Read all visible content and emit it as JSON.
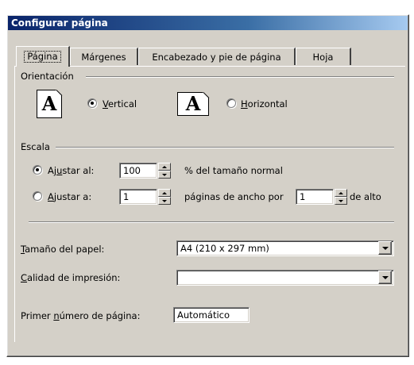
{
  "window": {
    "title": "Configurar página"
  },
  "tabs": [
    {
      "label": "Página",
      "active": true
    },
    {
      "label": "Márgenes",
      "active": false
    },
    {
      "label": "Encabezado y pie de página",
      "active": false
    },
    {
      "label": "Hoja",
      "active": false
    }
  ],
  "orientation": {
    "group_label": "Orientación",
    "portrait_icon_letter": "A",
    "portrait_label_mnemonic": "V",
    "portrait_label_rest": "ertical",
    "portrait_selected": true,
    "landscape_icon_letter": "A",
    "landscape_label_mnemonic": "H",
    "landscape_label_rest": "orizontal",
    "landscape_selected": false
  },
  "scale": {
    "group_label": "Escala",
    "adjust_label_pre": "Aj",
    "adjust_label_mnemonic": "u",
    "adjust_label_post": "star al:",
    "adjust_value": "100",
    "adjust_suffix": "% del tamaño normal",
    "adjust_selected": true,
    "fit_label_mnemonic": "A",
    "fit_label_rest": "justar a:",
    "fit_wide_value": "1",
    "fit_mid_text": "páginas de ancho por",
    "fit_tall_value": "1",
    "fit_suffix": "de alto",
    "fit_selected": false
  },
  "paper": {
    "size_label_mnemonic": "T",
    "size_label_rest": "amaño del papel:",
    "size_value": "A4 (210 x 297 mm)",
    "quality_label_mnemonic": "C",
    "quality_label_rest": "alidad de impresión:",
    "quality_value": "",
    "first_page_label_pre": "Primer ",
    "first_page_label_mnemonic": "n",
    "first_page_label_post": "úmero de página:",
    "first_page_value": "Automático"
  },
  "colors": {
    "dialog_face": "#d4d0c8",
    "title_gradient_start": "#0a246a",
    "title_gradient_end": "#a6caf0"
  },
  "icons": {
    "portrait": "portrait-page-icon",
    "landscape": "landscape-page-icon",
    "spin_up": "spin-up-arrow-icon",
    "spin_down": "spin-down-arrow-icon",
    "dropdown": "chevron-down-icon"
  }
}
